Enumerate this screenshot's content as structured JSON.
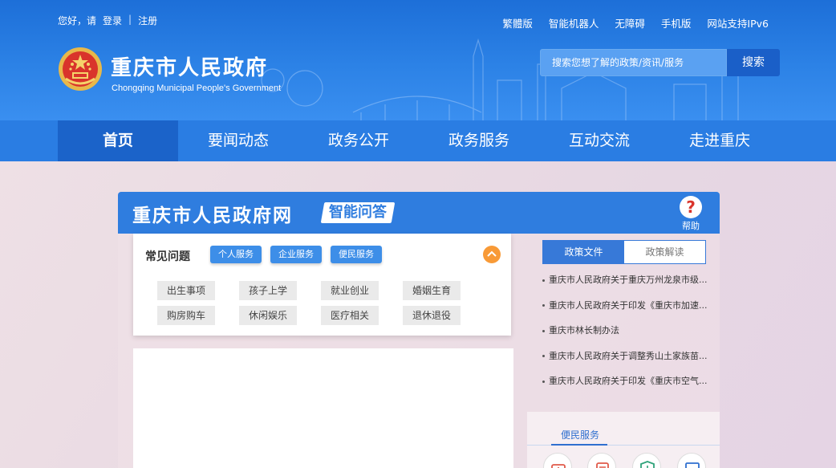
{
  "top_left": {
    "greeting": "您好，请",
    "login": "登录",
    "separator": "|",
    "register": "注册"
  },
  "top_right": [
    "繁體版",
    "智能机器人",
    "无障碍",
    "手机版",
    "网站支持IPv6"
  ],
  "site": {
    "title": "重庆市人民政府",
    "subtitle": "Chongqing Municipal People's Government"
  },
  "search": {
    "placeholder": "搜索您想了解的政策/资讯/服务",
    "button": "搜索"
  },
  "nav": [
    "首页",
    "要闻动态",
    "政务公开",
    "政务服务",
    "互动交流",
    "走进重庆"
  ],
  "nav_active": "首页",
  "panel": {
    "title": "重庆市人民政府网",
    "badge": "智能问答",
    "help_icon": "?",
    "help_label": "帮助"
  },
  "faq": {
    "title": "常见问题",
    "tabs": [
      "个人服务",
      "企业服务",
      "便民服务"
    ],
    "collapse_icon": "chevron-up-icon",
    "items": [
      "出生事项",
      "孩子上学",
      "就业创业",
      "婚姻生育",
      "购房购车",
      "休闲娱乐",
      "医疗相关",
      "退休退役"
    ]
  },
  "policy": {
    "tabs": [
      "政策文件",
      "政策解读"
    ],
    "items": [
      "重庆市人民政府关于重庆万州龙泉市级...",
      "重庆市人民政府关于印发《重庆市加速...",
      "重庆市林长制办法",
      "重庆市人民政府关于调整秀山土家族苗...",
      "重庆市人民政府关于印发《重庆市空气..."
    ]
  },
  "service": {
    "title": "便民服务"
  },
  "colors": {
    "header_blue": "#2c82e6",
    "nav_active": "#1b63c9",
    "accent_orange": "#f89a37",
    "emblem_red": "#d9342b"
  }
}
